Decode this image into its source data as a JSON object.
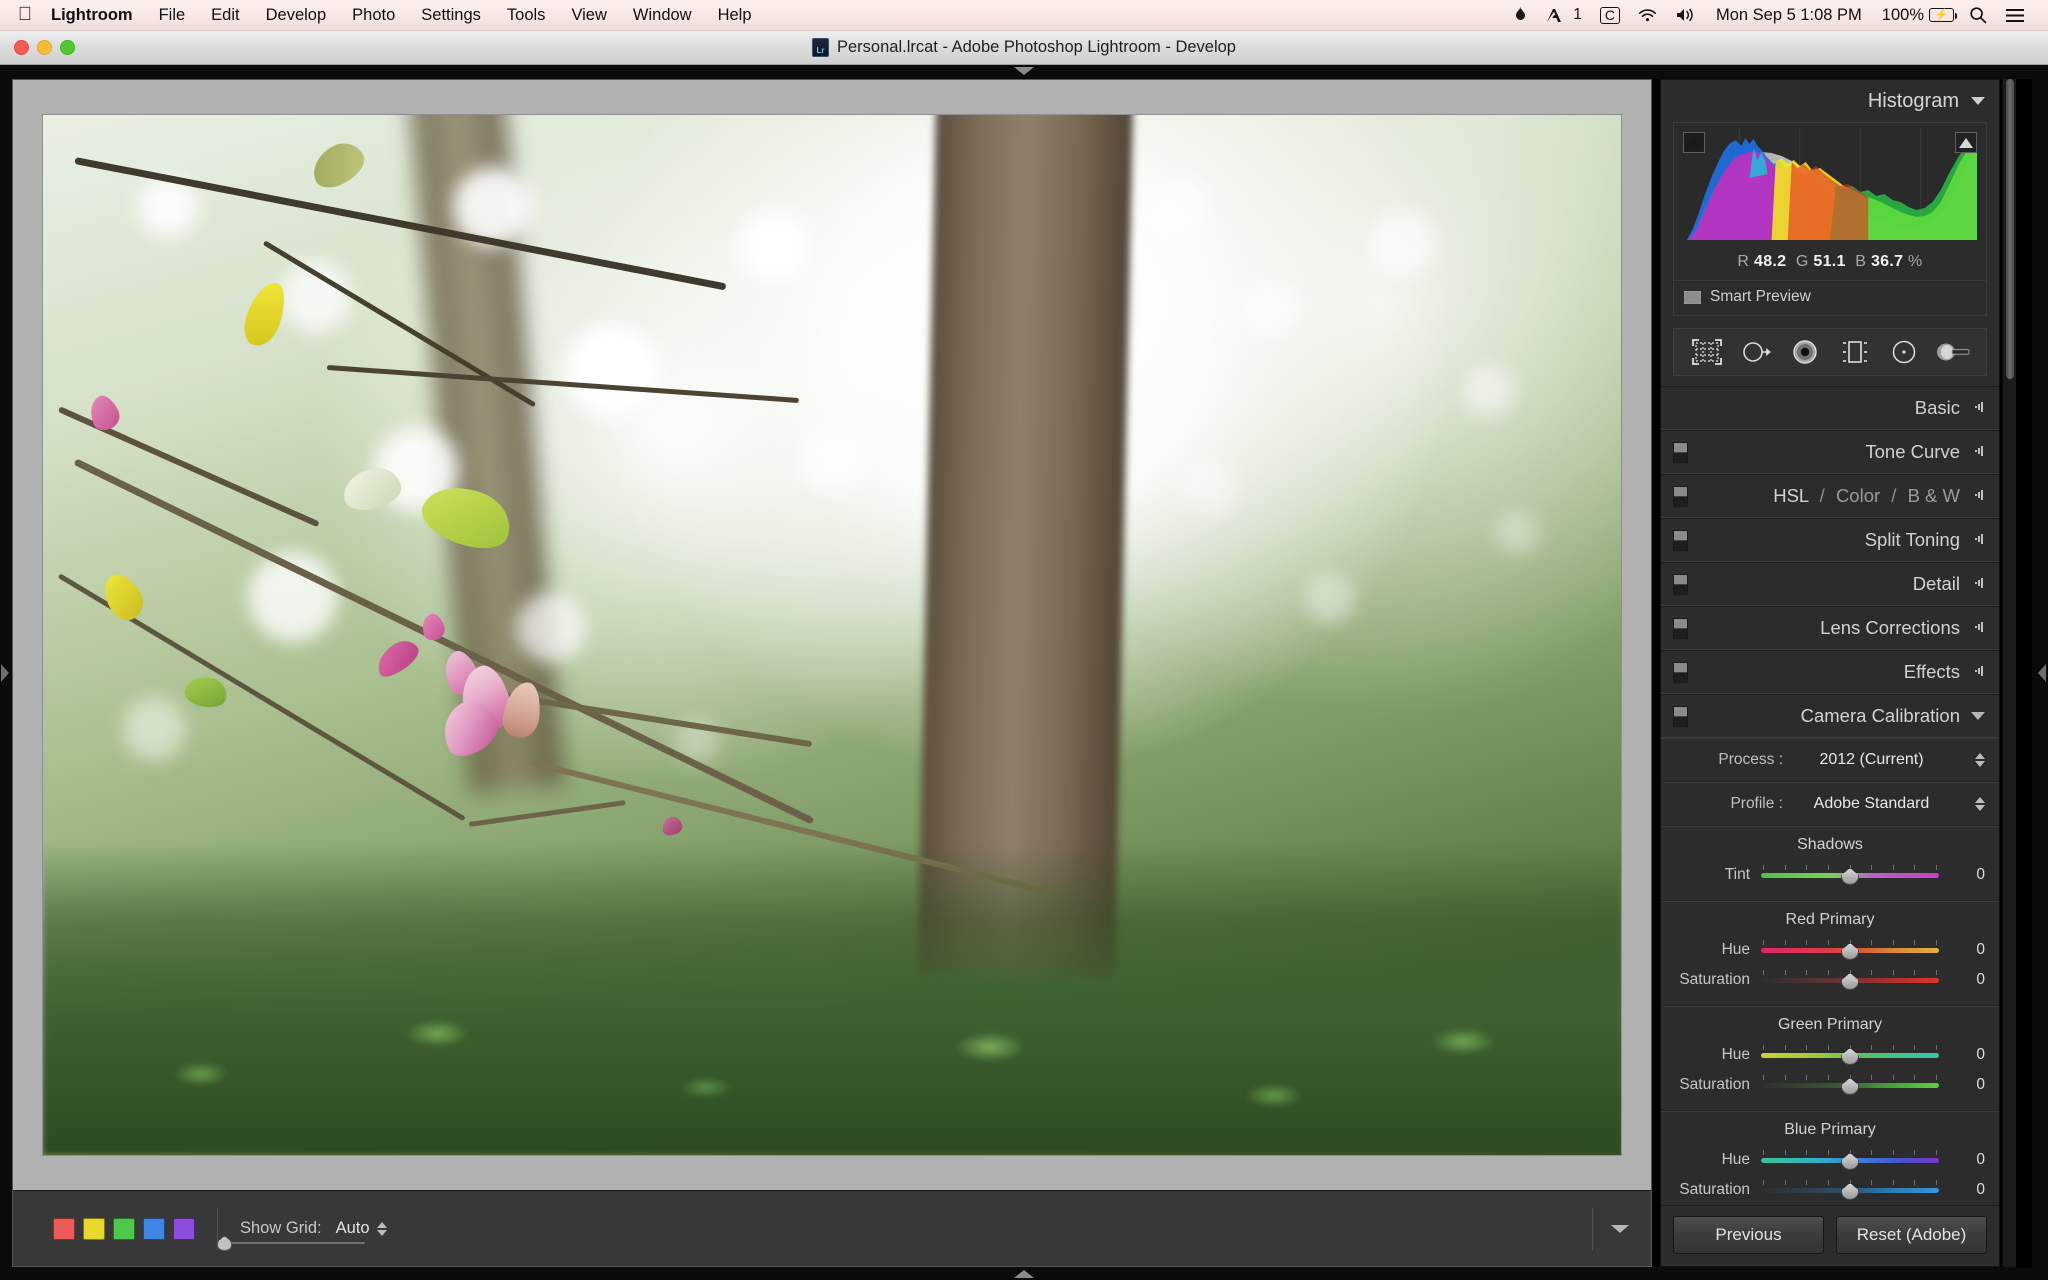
{
  "menubar": {
    "apple_icon": "apple-icon",
    "items": [
      {
        "label": "Lightroom",
        "bold": true
      },
      {
        "label": "File",
        "bold": false
      },
      {
        "label": "Edit",
        "bold": false
      },
      {
        "label": "Develop",
        "bold": false
      },
      {
        "label": "Photo",
        "bold": false
      },
      {
        "label": "Settings",
        "bold": false
      },
      {
        "label": "Tools",
        "bold": false
      },
      {
        "label": "View",
        "bold": false
      },
      {
        "label": "Window",
        "bold": false
      },
      {
        "label": "Help",
        "bold": false
      }
    ],
    "status": {
      "flame_icon": "flame-icon",
      "adobe_icon": "adobe-creative-cloud-icon",
      "adobe_badge": "1",
      "c_icon": "C",
      "wifi_icon": "wifi-icon",
      "volume_icon": "volume-icon",
      "clock": "Mon Sep 5  1:08 PM",
      "battery_percent": "100%",
      "search_icon": "search-icon",
      "menu_icon": "control-center-icon"
    }
  },
  "window": {
    "title": "Personal.lrcat - Adobe Photoshop Lightroom - Develop",
    "app_badge": "Lr",
    "close_label": "Close",
    "minimize_label": "Minimize",
    "zoom_label": "Zoom"
  },
  "histogram": {
    "title": "Histogram",
    "readout": {
      "r_label": "R",
      "r_value": "48.2",
      "g_label": "G",
      "g_value": "51.1",
      "b_label": "B",
      "b_value": "36.7",
      "unit": "%"
    },
    "smart_preview": "Smart Preview",
    "shadow_clipping_label": "Show Shadow Clipping",
    "highlight_clipping_label": "Show Highlight Clipping"
  },
  "toolstrip": {
    "tools": [
      {
        "name": "crop-overlay-tool",
        "label": "Crop Overlay"
      },
      {
        "name": "spot-removal-tool",
        "label": "Spot Removal"
      },
      {
        "name": "red-eye-correction-tool",
        "label": "Red Eye Correction"
      },
      {
        "name": "graduated-filter-tool",
        "label": "Graduated Filter"
      },
      {
        "name": "radial-filter-tool",
        "label": "Radial Filter"
      },
      {
        "name": "adjustment-brush-tool",
        "label": "Adjustment Brush"
      }
    ]
  },
  "panels": [
    {
      "id": "basic",
      "label": "Basic",
      "has_switch": false,
      "expanded": false
    },
    {
      "id": "tone-curve",
      "label": "Tone Curve",
      "has_switch": true,
      "expanded": false
    },
    {
      "id": "hsl-color-bw",
      "label": "HSL / Color / B & W",
      "has_switch": true,
      "expanded": false,
      "parts": [
        "HSL",
        "Color",
        "B & W"
      ]
    },
    {
      "id": "split-toning",
      "label": "Split Toning",
      "has_switch": true,
      "expanded": false
    },
    {
      "id": "detail",
      "label": "Detail",
      "has_switch": true,
      "expanded": false
    },
    {
      "id": "lens-corrections",
      "label": "Lens Corrections",
      "has_switch": true,
      "expanded": false
    },
    {
      "id": "effects",
      "label": "Effects",
      "has_switch": true,
      "expanded": false
    },
    {
      "id": "camera-calibration",
      "label": "Camera Calibration",
      "has_switch": true,
      "expanded": true
    }
  ],
  "camera_calibration": {
    "process": {
      "label": "Process :",
      "value": "2012 (Current)"
    },
    "profile": {
      "label": "Profile :",
      "value": "Adobe Standard"
    },
    "groups": [
      {
        "title": "Shadows",
        "sliders": [
          {
            "label": "Tint",
            "value": "0",
            "knob_pct": 50,
            "gradient": "linear-gradient(90deg,#4fbf4f 0%,#7ad24f 38%,#9e9e9e 50%,#b863c4 62%,#c93ec9 100%)"
          }
        ]
      },
      {
        "title": "Red Primary",
        "sliders": [
          {
            "label": "Hue",
            "value": "0",
            "knob_pct": 50,
            "gradient": "linear-gradient(90deg,#e0246a 0%,#e03c46 38%,#d8543a 52%,#d88a32 76%,#e2b43a 100%)"
          },
          {
            "label": "Saturation",
            "value": "0",
            "knob_pct": 50,
            "gradient": "linear-gradient(90deg,#2e2e2e 0%,#6a3434 46%,#a8312e 72%,#e03227 100%)"
          }
        ]
      },
      {
        "title": "Green Primary",
        "sliders": [
          {
            "label": "Hue",
            "value": "0",
            "knob_pct": 50,
            "gradient": "linear-gradient(90deg,#cdd134 0%,#9dc83c 32%,#52c45c 58%,#3cc49a 84%,#35c3b4 100%)"
          },
          {
            "label": "Saturation",
            "value": "0",
            "knob_pct": 50,
            "gradient": "linear-gradient(90deg,#2e2e2e 0%,#3a5c33 46%,#49a03c 72%,#5ad13e 100%)"
          }
        ]
      },
      {
        "title": "Blue Primary",
        "sliders": [
          {
            "label": "Hue",
            "value": "0",
            "knob_pct": 50,
            "gradient": "linear-gradient(90deg,#35c496 0%,#32b6c2 28%,#3a7fd0 56%,#4a4fd2 80%,#7a35c8 100%)"
          },
          {
            "label": "Saturation",
            "value": "0",
            "knob_pct": 50,
            "gradient": "linear-gradient(90deg,#2e2e2e 0%,#2f4c66 46%,#2f7cb4 74%,#3397e0 100%)"
          }
        ]
      }
    ]
  },
  "right_footer": {
    "previous": "Previous",
    "reset": "Reset (Adobe)"
  },
  "toolbar": {
    "swatches": [
      {
        "name": "flag-red",
        "color": "#ee5a5a"
      },
      {
        "name": "flag-yellow",
        "color": "#e8d829"
      },
      {
        "name": "flag-green",
        "color": "#4cc84c"
      },
      {
        "name": "flag-blue",
        "color": "#3f86e8"
      },
      {
        "name": "flag-purple",
        "color": "#8e4ce0"
      }
    ],
    "show_grid_label": "Show Grid:",
    "show_grid_value": "Auto",
    "grid_size_value": 4,
    "toolbar_chooser_label": "Choose toolbar items"
  },
  "chrome": {
    "left_panel_expand": "Show left panel",
    "right_panel_expand": "Show right panel",
    "top_panel_collapse": "Hide module picker",
    "bottom_panel_collapse": "Show filmstrip"
  },
  "photo": {
    "alt": "Magnolia branch with pink blossom against bright forest canopy",
    "colors": {
      "blossom_pink": "#d87aa8",
      "blossom_light": "#efc3d4",
      "leaf_yellow": "#e8dd2c",
      "leaf_green": "#b9d14a",
      "branch_brown": "#4e4535",
      "canopy_green": "#6f9a4e"
    }
  }
}
